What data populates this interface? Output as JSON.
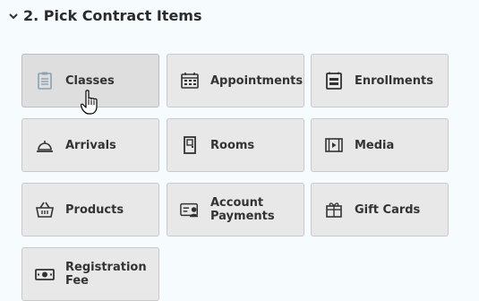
{
  "section": {
    "title": "2. Pick Contract Items"
  },
  "tiles": [
    {
      "label": "Classes",
      "icon": "clipboard-icon"
    },
    {
      "label": "Appointments",
      "icon": "calendar-icon"
    },
    {
      "label": "Enrollments",
      "icon": "enrollment-icon"
    },
    {
      "label": "Arrivals",
      "icon": "service-bell-icon"
    },
    {
      "label": "Rooms",
      "icon": "door-icon"
    },
    {
      "label": "Media",
      "icon": "film-icon"
    },
    {
      "label": "Products",
      "icon": "basket-icon"
    },
    {
      "label": "Account Payments",
      "label_line1": "Account",
      "label_line2": "Payments",
      "icon": "id-card-icon"
    },
    {
      "label": "Gift Cards",
      "icon": "gift-card-icon"
    },
    {
      "label": "Registration Fee",
      "icon": "cash-icon"
    }
  ],
  "colors": {
    "tile_bg": "#e8e8e8",
    "tile_border": "#c9c9c9",
    "icon": "#333333",
    "page_bg": "#f6fcfd"
  }
}
